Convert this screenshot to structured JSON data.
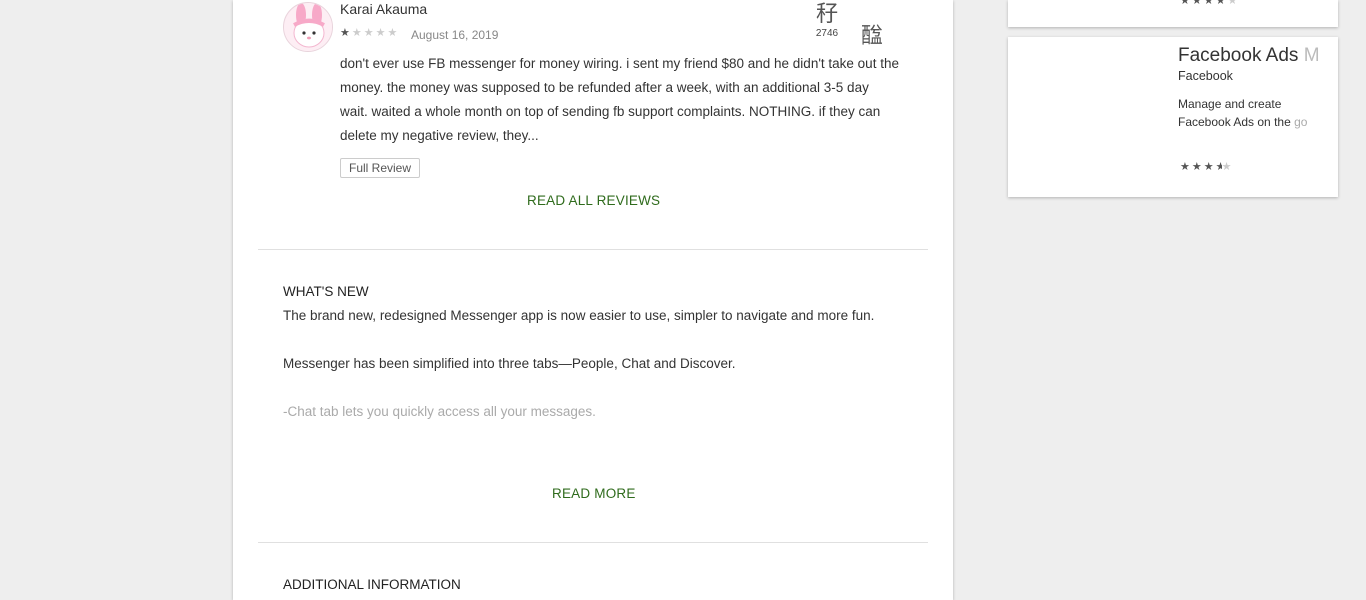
{
  "review": {
    "reviewer_name": "Karai Akauma",
    "rating": 1,
    "stars_on": "★",
    "stars_off": "★★★★",
    "date": "August 16, 2019",
    "glyph_top": "秄",
    "count": "2746",
    "glyph_side": "䤈",
    "body": "don't ever use FB messenger for money wiring. i sent my friend $80 and he didn't take out the money. the money was supposed to be refunded after a week, with an additional 3-5 day wait. waited a whole month on top of sending fb support complaints. NOTHING. if they can delete my negative review, they...",
    "full_review_label": "Full Review"
  },
  "links": {
    "read_all_reviews": "READ ALL REVIEWS",
    "read_more": "READ MORE"
  },
  "whats_new": {
    "heading": "WHAT'S NEW",
    "para1": "The brand new, redesigned Messenger app is now easier to use, simpler to navigate and more fun.",
    "para2": "Messenger has been simplified into three tabs—People, Chat and Discover.",
    "para3": "-Chat tab lets you quickly access all your messages."
  },
  "additional_info": {
    "heading": "ADDITIONAL INFORMATION"
  },
  "side_top": {
    "rating": 4,
    "stars_on": "★★★★",
    "stars_off": "★"
  },
  "side_app": {
    "title_start": "Facebook Ads ",
    "title_fade": "M",
    "developer": "Facebook",
    "desc_start": "Manage and create Facebook Ads on the ",
    "desc_fade": "go",
    "rating": 3.5,
    "stars_on": "★★★",
    "stars_half": "★",
    "stars_off": "★"
  },
  "colors": {
    "link_green": "#2f6b1c",
    "star_on": "#555555",
    "star_off": "#cccccc",
    "page_bg": "#eeeeee"
  }
}
